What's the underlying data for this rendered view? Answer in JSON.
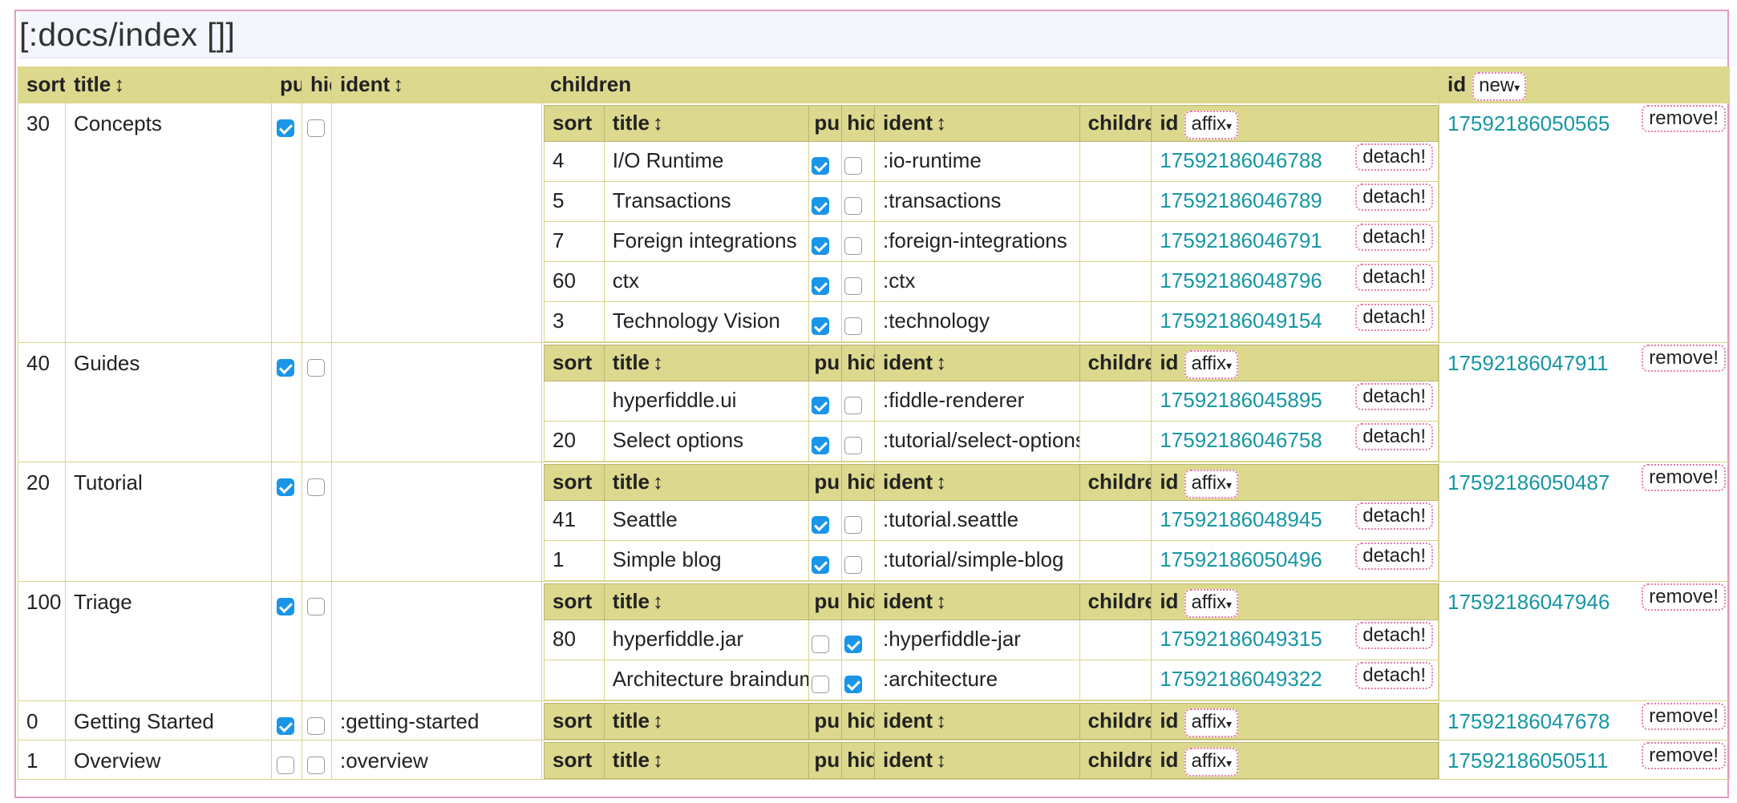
{
  "page": {
    "title": "[:docs/index []]"
  },
  "outer_headers": {
    "sort": "sort",
    "title": "title",
    "published": "pu",
    "hidden": "hid",
    "ident": "ident",
    "children": "children",
    "id": "id",
    "id_select": "new"
  },
  "inner_headers": {
    "sort": "sort",
    "title": "title",
    "published": "pu",
    "hidden": "hid",
    "ident": "ident",
    "children": "children",
    "id": "id",
    "id_select": "affix"
  },
  "sort_indicator": "↕",
  "caret": "▾",
  "remove_label": "remove!",
  "detach_label": "detach!",
  "rows": [
    {
      "sort": "30",
      "title": "Concepts",
      "published": true,
      "hidden": false,
      "ident": "",
      "id": "17592186050565",
      "children": [
        {
          "sort": "4",
          "title": "I/O Runtime",
          "published": true,
          "hidden": false,
          "ident": ":io-runtime",
          "id": "17592186046788"
        },
        {
          "sort": "5",
          "title": "Transactions",
          "published": true,
          "hidden": false,
          "ident": ":transactions",
          "id": "17592186046789"
        },
        {
          "sort": "7",
          "title": "Foreign integrations",
          "published": true,
          "hidden": false,
          "ident": ":foreign-integrations",
          "id": "17592186046791"
        },
        {
          "sort": "60",
          "title": "ctx",
          "published": true,
          "hidden": false,
          "ident": ":ctx",
          "id": "17592186048796"
        },
        {
          "sort": "3",
          "title": "Technology Vision",
          "published": true,
          "hidden": false,
          "ident": ":technology",
          "id": "17592186049154"
        }
      ]
    },
    {
      "sort": "40",
      "title": "Guides",
      "published": true,
      "hidden": false,
      "ident": "",
      "id": "17592186047911",
      "children": [
        {
          "sort": "",
          "title": "hyperfiddle.ui",
          "published": true,
          "hidden": false,
          "ident": ":fiddle-renderer",
          "id": "17592186045895"
        },
        {
          "sort": "20",
          "title": "Select options",
          "published": true,
          "hidden": false,
          "ident": ":tutorial/select-options",
          "id": "17592186046758"
        }
      ]
    },
    {
      "sort": "20",
      "title": "Tutorial",
      "published": true,
      "hidden": false,
      "ident": "",
      "id": "17592186050487",
      "children": [
        {
          "sort": "41",
          "title": "Seattle",
          "published": true,
          "hidden": false,
          "ident": ":tutorial.seattle",
          "id": "17592186048945"
        },
        {
          "sort": "1",
          "title": "Simple blog",
          "published": true,
          "hidden": false,
          "ident": ":tutorial/simple-blog",
          "id": "17592186050496"
        }
      ]
    },
    {
      "sort": "100",
      "title": "Triage",
      "published": true,
      "hidden": false,
      "ident": "",
      "id": "17592186047946",
      "children": [
        {
          "sort": "80",
          "title": "hyperfiddle.jar",
          "published": false,
          "hidden": true,
          "ident": ":hyperfiddle-jar",
          "id": "17592186049315"
        },
        {
          "sort": "",
          "title": "Architecture braindump",
          "published": false,
          "hidden": true,
          "ident": ":architecture",
          "id": "17592186049322"
        }
      ]
    },
    {
      "sort": "0",
      "title": "Getting Started",
      "published": true,
      "hidden": false,
      "ident": ":getting-started",
      "id": "17592186047678",
      "children": []
    },
    {
      "sort": "1",
      "title": "Overview",
      "published": false,
      "hidden": false,
      "ident": ":overview",
      "id": "17592186050511",
      "children": []
    }
  ]
}
